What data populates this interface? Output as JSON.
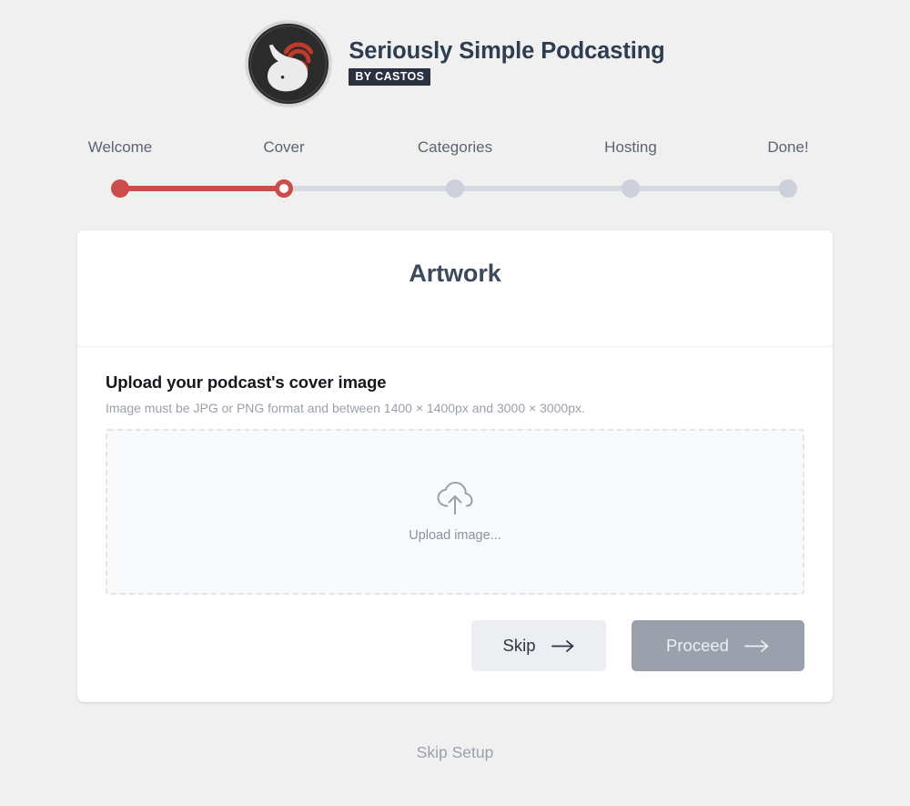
{
  "brand": {
    "logo_icon": "castos-whale-logo",
    "title": "Seriously Simple Podcasting",
    "badge": "BY CASTOS"
  },
  "stepper": {
    "active_index": 1,
    "steps": [
      {
        "label": "Welcome",
        "state": "done"
      },
      {
        "label": "Cover",
        "state": "active"
      },
      {
        "label": "Categories",
        "state": "todo"
      },
      {
        "label": "Hosting",
        "state": "todo"
      },
      {
        "label": "Done!",
        "state": "todo"
      }
    ],
    "colors": {
      "active": "#cc4b4b",
      "inactive": "#cbd0da",
      "track": "#d5d9e0"
    }
  },
  "card": {
    "title": "Artwork",
    "section_heading": "Upload your podcast's cover image",
    "section_sub": "Image must be JPG or PNG format and between 1400 × 1400px and 3000 × 3000px.",
    "dropzone": {
      "icon": "cloud-upload-icon",
      "text": "Upload image..."
    },
    "buttons": {
      "skip": "Skip",
      "proceed": "Proceed",
      "arrow_icon": "arrow-right-icon",
      "proceed_disabled": true
    }
  },
  "footer": {
    "skip_setup": "Skip Setup"
  },
  "theme": {
    "page_bg": "#f0f0f1",
    "card_bg": "#ffffff",
    "title_color": "#2e3d50",
    "accent_red": "#cc4b4b"
  }
}
